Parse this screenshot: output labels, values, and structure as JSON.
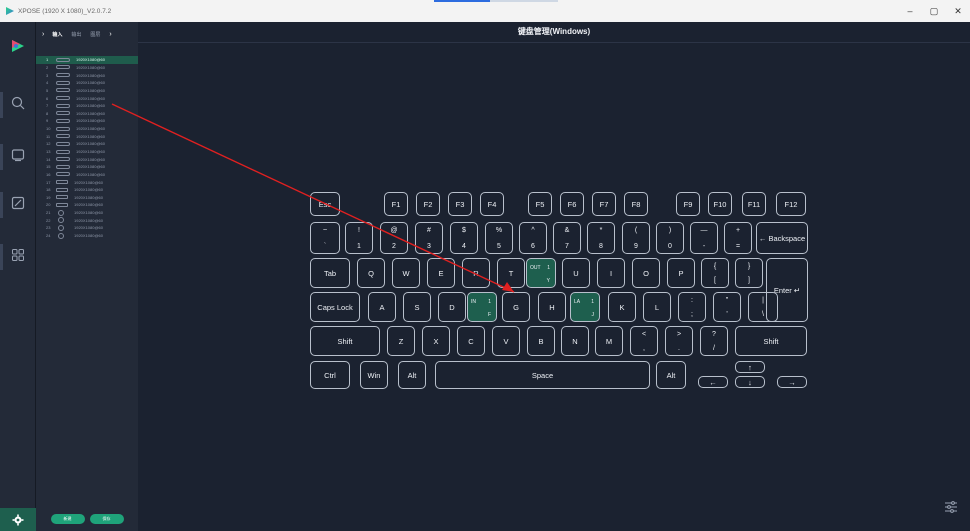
{
  "window": {
    "title": "XPOSE (1920 X 1080)_V2.0.7.2",
    "minimize": "–",
    "maximize": "▢",
    "close": "✕",
    "progress": 0.45
  },
  "sidebar": {
    "items": [
      {
        "icon": "search-icon"
      },
      {
        "icon": "monitor-icon"
      },
      {
        "icon": "edit-icon"
      },
      {
        "icon": "grid-icon"
      }
    ],
    "settings_icon": "gear-icon"
  },
  "panel": {
    "tabs": [
      "输入",
      "输出",
      "图层"
    ],
    "rows": [
      {
        "num": "1",
        "res": "1920X1080@60",
        "type": "hdmi"
      },
      {
        "num": "2",
        "res": "1920X1080@60",
        "type": "hdmi"
      },
      {
        "num": "3",
        "res": "1920X1080@60",
        "type": "hdmi"
      },
      {
        "num": "4",
        "res": "1920X1080@60",
        "type": "hdmi"
      },
      {
        "num": "5",
        "res": "1920X1080@60",
        "type": "hdmi"
      },
      {
        "num": "6",
        "res": "1920X1080@60",
        "type": "hdmi"
      },
      {
        "num": "7",
        "res": "1920X1080@60",
        "type": "hdmi"
      },
      {
        "num": "8",
        "res": "1920X1080@60",
        "type": "hdmi"
      },
      {
        "num": "9",
        "res": "1920X1080@60",
        "type": "hdmi"
      },
      {
        "num": "10",
        "res": "1920X1080@60",
        "type": "hdmi"
      },
      {
        "num": "11",
        "res": "1920X1080@60",
        "type": "hdmi"
      },
      {
        "num": "12",
        "res": "1920X1080@60",
        "type": "hdmi"
      },
      {
        "num": "13",
        "res": "1920X1080@60",
        "type": "hdmi"
      },
      {
        "num": "14",
        "res": "1920X1080@60",
        "type": "hdmi"
      },
      {
        "num": "15",
        "res": "1920X1080@60",
        "type": "hdmi"
      },
      {
        "num": "16",
        "res": "1920X1080@60",
        "type": "hdmi"
      },
      {
        "num": "17",
        "res": "1920X1080@60",
        "type": "dvi"
      },
      {
        "num": "18",
        "res": "1920X1080@60",
        "type": "dvi"
      },
      {
        "num": "19",
        "res": "1920X1080@60",
        "type": "dvi"
      },
      {
        "num": "20",
        "res": "1920X1080@60",
        "type": "dvi"
      },
      {
        "num": "21",
        "res": "1920X1080@60",
        "type": "sdi"
      },
      {
        "num": "22",
        "res": "1920X1080@60",
        "type": "sdi"
      },
      {
        "num": "23",
        "res": "1920X1080@60",
        "type": "sdi"
      },
      {
        "num": "24",
        "res": "1920X1080@60",
        "type": "sdi"
      }
    ],
    "selected_row": 0,
    "footer_buttons": [
      "新建",
      "保存"
    ]
  },
  "main": {
    "title": "键盘管理(Windows)"
  },
  "keyboard": {
    "rows": [
      [
        {
          "label": "Esc"
        },
        {
          "label": "F1"
        },
        {
          "label": "F2"
        },
        {
          "label": "F3"
        },
        {
          "label": "F4"
        },
        {
          "label": "F5"
        },
        {
          "label": "F6"
        },
        {
          "label": "F7"
        },
        {
          "label": "F8"
        },
        {
          "label": "F9"
        },
        {
          "label": "F10"
        },
        {
          "label": "F11"
        },
        {
          "label": "F12"
        }
      ],
      [
        {
          "top": "~",
          "bot": "`"
        },
        {
          "top": "!",
          "bot": "1"
        },
        {
          "top": "@",
          "bot": "2"
        },
        {
          "top": "#",
          "bot": "3"
        },
        {
          "top": "$",
          "bot": "4"
        },
        {
          "top": "%",
          "bot": "5"
        },
        {
          "top": "^",
          "bot": "6"
        },
        {
          "top": "&",
          "bot": "7"
        },
        {
          "top": "*",
          "bot": "8"
        },
        {
          "top": "(",
          "bot": "9"
        },
        {
          "top": ")",
          "bot": "0"
        },
        {
          "top": "—",
          "bot": "-"
        },
        {
          "top": "+",
          "bot": "="
        },
        {
          "label": "← Backspace"
        }
      ],
      [
        {
          "label": "Tab"
        },
        {
          "label": "Q"
        },
        {
          "label": "W"
        },
        {
          "label": "E"
        },
        {
          "label": "R"
        },
        {
          "label": "T"
        },
        {
          "tag": "OUT",
          "tagnum": "1",
          "tagch": "Y",
          "active": true
        },
        {
          "label": "U"
        },
        {
          "label": "I"
        },
        {
          "label": "O"
        },
        {
          "label": "P"
        },
        {
          "top": "{",
          "bot": "["
        },
        {
          "top": "}",
          "bot": "]"
        },
        {
          "label": "Enter ↵"
        }
      ],
      [
        {
          "label": "Caps Lock"
        },
        {
          "label": "A"
        },
        {
          "label": "S"
        },
        {
          "label": "D"
        },
        {
          "tag": "IN",
          "tagnum": "1",
          "tagch": "F",
          "active": true
        },
        {
          "label": "G"
        },
        {
          "label": "H"
        },
        {
          "tag": "LA",
          "tagnum": "1",
          "tagch": "J",
          "active": true
        },
        {
          "label": "K"
        },
        {
          "label": "L"
        },
        {
          "top": ":",
          "bot": ";"
        },
        {
          "top": "\"",
          "bot": "'"
        },
        {
          "top": "|",
          "bot": "\\"
        }
      ],
      [
        {
          "label": "Shift"
        },
        {
          "label": "Z"
        },
        {
          "label": "X"
        },
        {
          "label": "C"
        },
        {
          "label": "V"
        },
        {
          "label": "B"
        },
        {
          "label": "N"
        },
        {
          "label": "M"
        },
        {
          "top": "<",
          "bot": ","
        },
        {
          "top": ">",
          "bot": "."
        },
        {
          "top": "?",
          "bot": "/"
        },
        {
          "label": "Shift"
        }
      ],
      [
        {
          "label": "Ctrl"
        },
        {
          "label": "Win"
        },
        {
          "label": "Alt"
        },
        {
          "label": "Space"
        },
        {
          "label": "Alt"
        },
        {
          "label": "←"
        },
        {
          "label": "↑"
        },
        {
          "label": "↓"
        },
        {
          "label": "→"
        }
      ]
    ]
  },
  "colors": {
    "accent": "#1e5f4e",
    "annotation_arrow": "#e02020",
    "button_green": "#1fa37a"
  }
}
